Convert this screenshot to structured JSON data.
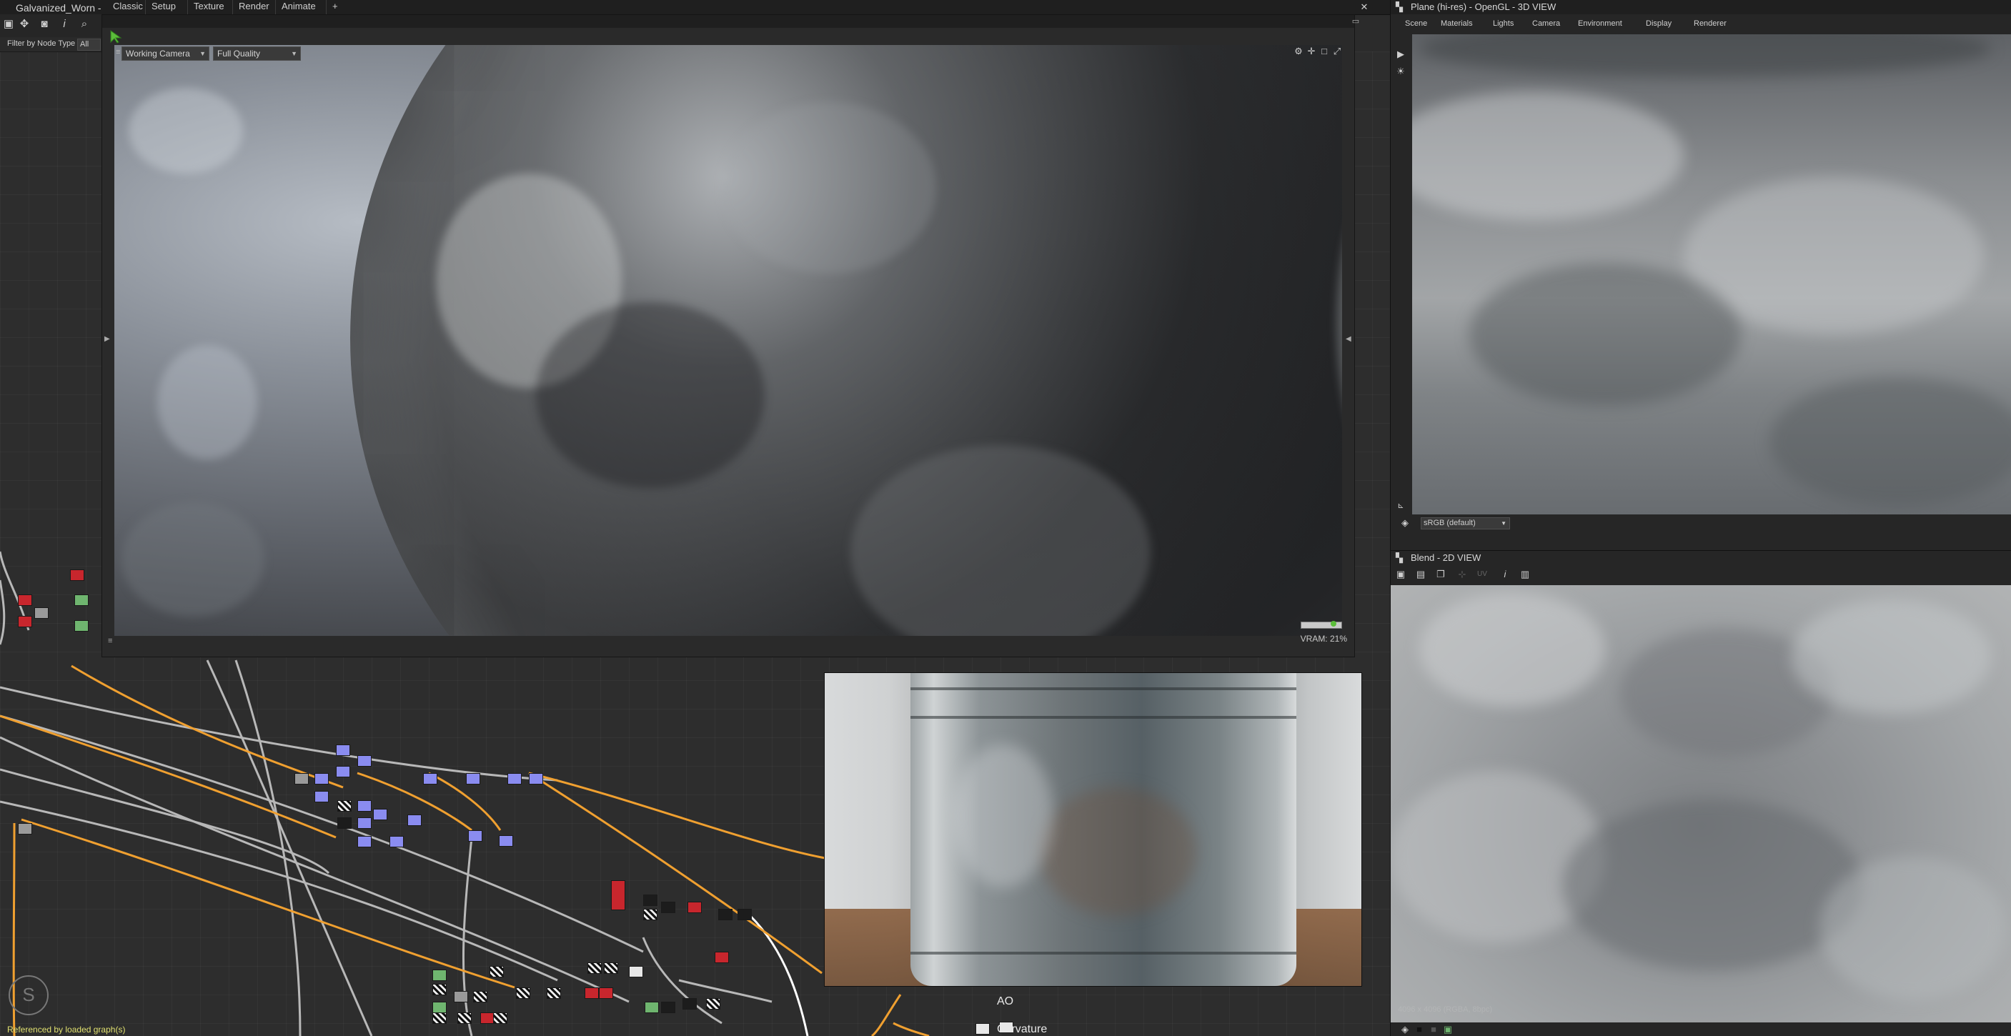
{
  "app": {
    "window_title": "Galvanized_Worn - ",
    "menu": [
      "Classic",
      "Setup",
      "Texture",
      "Render",
      "Animate",
      "+"
    ]
  },
  "left_panel": {
    "filter_label": "Filter by Node Type",
    "filter_value": "All",
    "tools": [
      "frame-tool-icon",
      "move-tool-icon",
      "camera-tool-icon",
      "info-tool-icon",
      "search-icon"
    ]
  },
  "viewport": {
    "camera": "Working Camera",
    "quality": "Full Quality",
    "vram": "VRAM: 21%"
  },
  "view3d": {
    "title": "Plane (hi-res) - OpenGL - 3D VIEW",
    "menu": [
      "Scene",
      "Materials",
      "Lights",
      "Camera",
      "Environment",
      "Display",
      "Renderer"
    ],
    "colorspace": "sRGB (default)"
  },
  "view2d": {
    "title": "Blend - 2D VIEW",
    "status": "4096 x 4096 (RGBA, 8bpc)"
  },
  "graph": {
    "ao_label": "AO",
    "curvature_label": "Curvature",
    "footer_note": "Referenced by loaded graph(s)"
  },
  "colors": {
    "accent_orange": "#f0a030",
    "wire_gray": "#b8b8b8",
    "node_blue": "#8a8cf0",
    "node_red": "#c8262d",
    "node_green": "#6fb56f",
    "cursor_green": "#5bbd3a"
  }
}
